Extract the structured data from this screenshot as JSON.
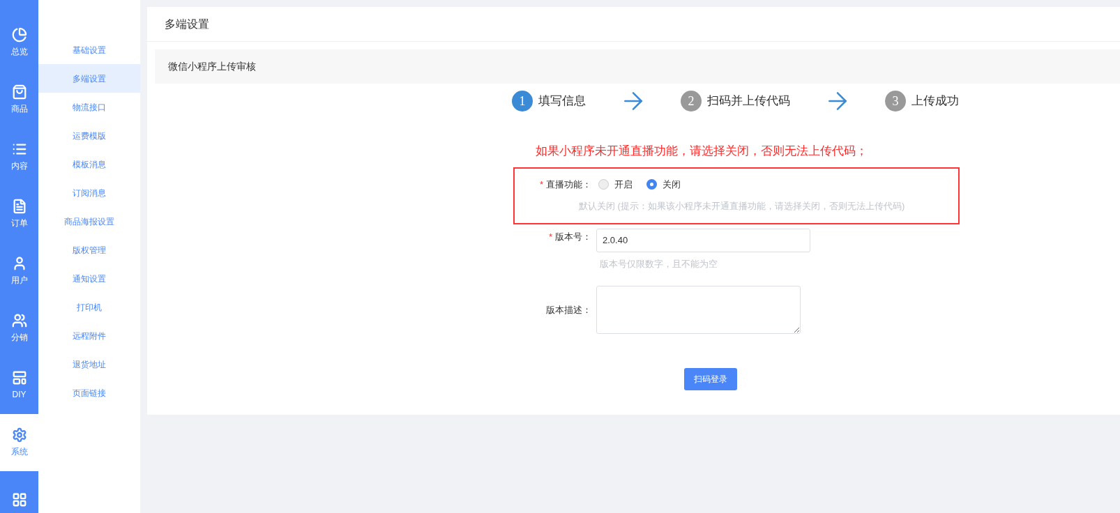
{
  "nav_rail": [
    {
      "label": "总览",
      "selected": false
    },
    {
      "label": "商品",
      "selected": false
    },
    {
      "label": "内容",
      "selected": false
    },
    {
      "label": "订单",
      "selected": false
    },
    {
      "label": "用户",
      "selected": false
    },
    {
      "label": "分销",
      "selected": false
    },
    {
      "label": "DIY",
      "selected": false
    },
    {
      "label": "系统",
      "selected": true
    },
    {
      "selected": false
    }
  ],
  "submenu": [
    {
      "label": "基础设置",
      "selected": false
    },
    {
      "label": "多端设置",
      "selected": true
    },
    {
      "label": "物流接口",
      "selected": false
    },
    {
      "label": "运费模版",
      "selected": false
    },
    {
      "label": "模板消息",
      "selected": false
    },
    {
      "label": "订阅消息",
      "selected": false
    },
    {
      "label": "商品海报设置",
      "selected": false
    },
    {
      "label": "版权管理",
      "selected": false
    },
    {
      "label": "通知设置",
      "selected": false
    },
    {
      "label": "打印机",
      "selected": false
    },
    {
      "label": "远程附件",
      "selected": false
    },
    {
      "label": "退货地址",
      "selected": false
    },
    {
      "label": "页面链接",
      "selected": false
    }
  ],
  "page_title": "多端设置",
  "section_title": "微信小程序上传审核",
  "steps": [
    {
      "number": "1",
      "label": "填写信息",
      "selected": true
    },
    {
      "number": "2",
      "label": "扫码并上传代码",
      "selected": false
    },
    {
      "number": "3",
      "label": "上传成功",
      "selected": false
    }
  ],
  "warning": "如果小程序未开通直播功能，请选择关闭，否则无法上传代码；",
  "live_field": {
    "label": "直播功能：",
    "required_mark": "*",
    "options": [
      {
        "label": "开启",
        "selected": false
      },
      {
        "label": "关闭",
        "selected": true
      }
    ],
    "hint": "默认关闭 (提示：如果该小程序未开通直播功能，请选择关闭，否则无法上传代码)"
  },
  "version_field": {
    "label": "版本号：",
    "required_mark": "*",
    "value": "2.0.40",
    "hint": "版本号仅限数字，且不能为空"
  },
  "description_field": {
    "label": "版本描述："
  },
  "submit_button": "扫码登录"
}
